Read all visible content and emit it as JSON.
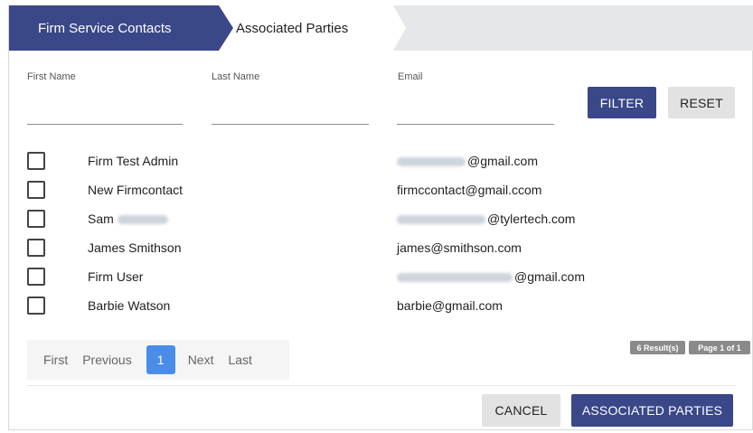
{
  "tabs": [
    {
      "label": "Firm Service Contacts"
    },
    {
      "label": "Associated Parties"
    }
  ],
  "filters": {
    "first_name_label": "First Name",
    "first_name_value": "",
    "last_name_label": "Last Name",
    "last_name_value": "",
    "email_label": "Email",
    "email_value": "",
    "filter_button": "FILTER",
    "reset_button": "RESET"
  },
  "contacts": [
    {
      "name": "Firm Test Admin",
      "email_visible": "@gmail.com"
    },
    {
      "name": "New Firmcontact",
      "email_visible": "firmccontact@gmail.ccom"
    },
    {
      "name": "Sam",
      "email_visible": "@tylertech.com"
    },
    {
      "name": "James Smithson",
      "email_visible": "james@smithson.com"
    },
    {
      "name": "Firm User",
      "email_visible": "@gmail.com"
    },
    {
      "name": "Barbie Watson",
      "email_visible": "barbie@gmail.com"
    }
  ],
  "pagination": {
    "first": "First",
    "previous": "Previous",
    "current_page": "1",
    "next": "Next",
    "last": "Last",
    "results": "6 Result(s)",
    "page_info": "Page 1 of 1"
  },
  "footer": {
    "cancel_button": "CANCEL",
    "associated_parties_button": "ASSOCIATED PARTIES"
  },
  "colors": {
    "primary": "#3a4788",
    "active_page": "#4a8de8"
  }
}
